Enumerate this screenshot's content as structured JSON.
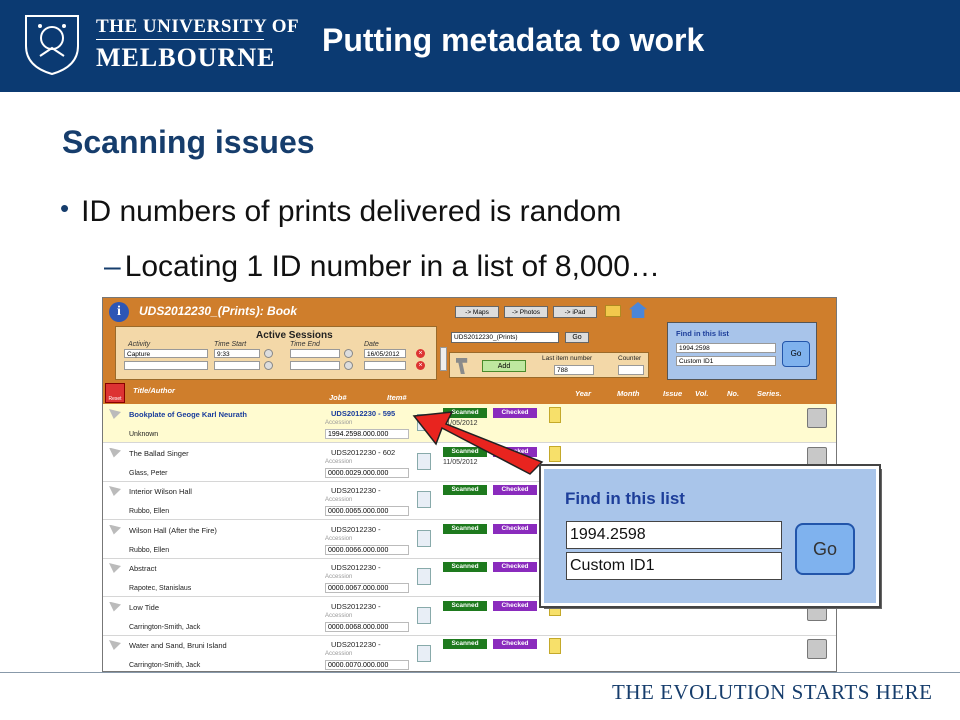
{
  "header": {
    "university_line1": "THE UNIVERSITY OF",
    "university_line2": "MELBOURNE",
    "title": "Putting metadata to work",
    "brand_color": "#0b3a72"
  },
  "slide": {
    "subtitle": "Scanning issues",
    "bullet": "ID numbers of prints delivered is random",
    "sub_bullet": "Locating 1 ID number in a list of 8,000…"
  },
  "app": {
    "title": "UDS2012230_(Prints): Book",
    "sessions": {
      "title": "Active Sessions",
      "columns": [
        "Activity",
        "Time Start",
        "Time End",
        "Date"
      ],
      "row": {
        "activity": "Capture",
        "time_start": "9:33",
        "time_end": "",
        "date": "16/05/2012"
      }
    },
    "nav_buttons": [
      "-> Maps",
      "-> Photos",
      "-> iPad"
    ],
    "id_field": "UDS2012230_(Prints)",
    "go_label": "Go",
    "add_label": "Add",
    "last_item_label": "Last item number",
    "last_item_value": "788",
    "counter_label": "Counter",
    "find_mini": {
      "title": "Find in this list",
      "value1": "1994.2598",
      "value2": "Custom ID1",
      "go": "Go"
    },
    "reset_label": "Reset",
    "columns": {
      "title": "Title/Author",
      "job": "Job#",
      "item": "Item#",
      "year": "Year",
      "month": "Month",
      "issue": "Issue",
      "vol": "Vol.",
      "no": "No.",
      "series": "Series."
    },
    "accession_label": "Accession",
    "scanned_label": "Scanned",
    "checked_label": "Checked",
    "rows": [
      {
        "title": "Bookplate of Geoge Karl Neurath",
        "person": "Unknown",
        "job": "UDS2012230 - 595",
        "accession": "1994.2598.000.000",
        "date": "11/05/2012"
      },
      {
        "title": "The Ballad Singer",
        "person": "Glass, Peter",
        "job": "UDS2012230 - 602",
        "accession": "0000.0029.000.000",
        "date": "11/05/2012"
      },
      {
        "title": "Interior Wilson Hall",
        "person": "Rubbo, Ellen",
        "job": "UDS2012230 -",
        "accession": "0000.0065.000.000",
        "date": ""
      },
      {
        "title": "Wilson Hall (After the Fire)",
        "person": "Rubbo, Ellen",
        "job": "UDS2012230 -",
        "accession": "0000.0066.000.000",
        "date": ""
      },
      {
        "title": "Abstract",
        "person": "Rapotec, Stanislaus",
        "job": "UDS2012230 -",
        "accession": "0000.0067.000.000",
        "date": ""
      },
      {
        "title": "Low Tide",
        "person": "Carrington-Smith, Jack",
        "job": "UDS2012230 -",
        "accession": "0000.0068.000.000",
        "date": ""
      },
      {
        "title": "Water and Sand, Bruni Island",
        "person": "Carrington-Smith, Jack",
        "job": "UDS2012230 -",
        "accession": "0000.0070.000.000",
        "date": ""
      }
    ]
  },
  "zoom_panel": {
    "title": "Find in this list",
    "value1": "1994.2598",
    "value2": "Custom ID1",
    "go": "Go"
  },
  "footer": {
    "tagline": "THE EVOLUTION STARTS HERE"
  }
}
